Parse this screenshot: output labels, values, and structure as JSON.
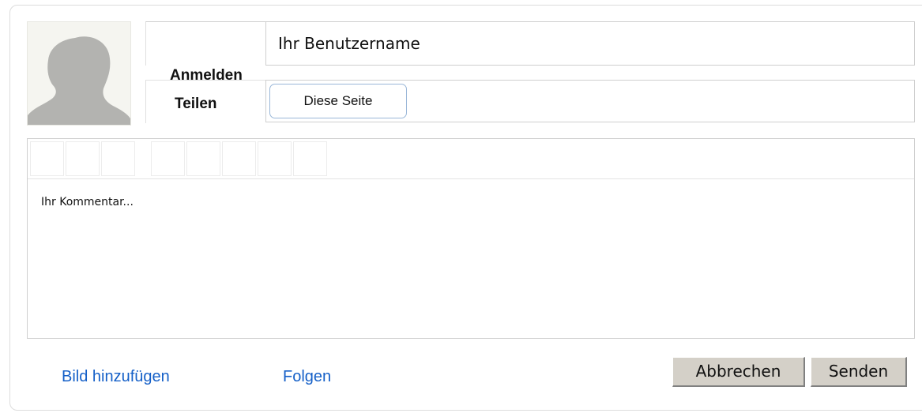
{
  "login": {
    "username_placeholder": "Ihr Benutzername",
    "login_label": "Anmelden"
  },
  "share": {
    "label": "Teilen",
    "button_label": "Diese Seite"
  },
  "comment": {
    "placeholder": "Ihr Kommentar..."
  },
  "footer": {
    "add_image_label": "Bild hinzufügen",
    "follow_label": "Folgen",
    "cancel_label": "Abbrechen",
    "send_label": "Senden"
  },
  "colors": {
    "link": "#1560c8",
    "button_face": "#d4d0c8",
    "border": "#cfcfcf"
  }
}
